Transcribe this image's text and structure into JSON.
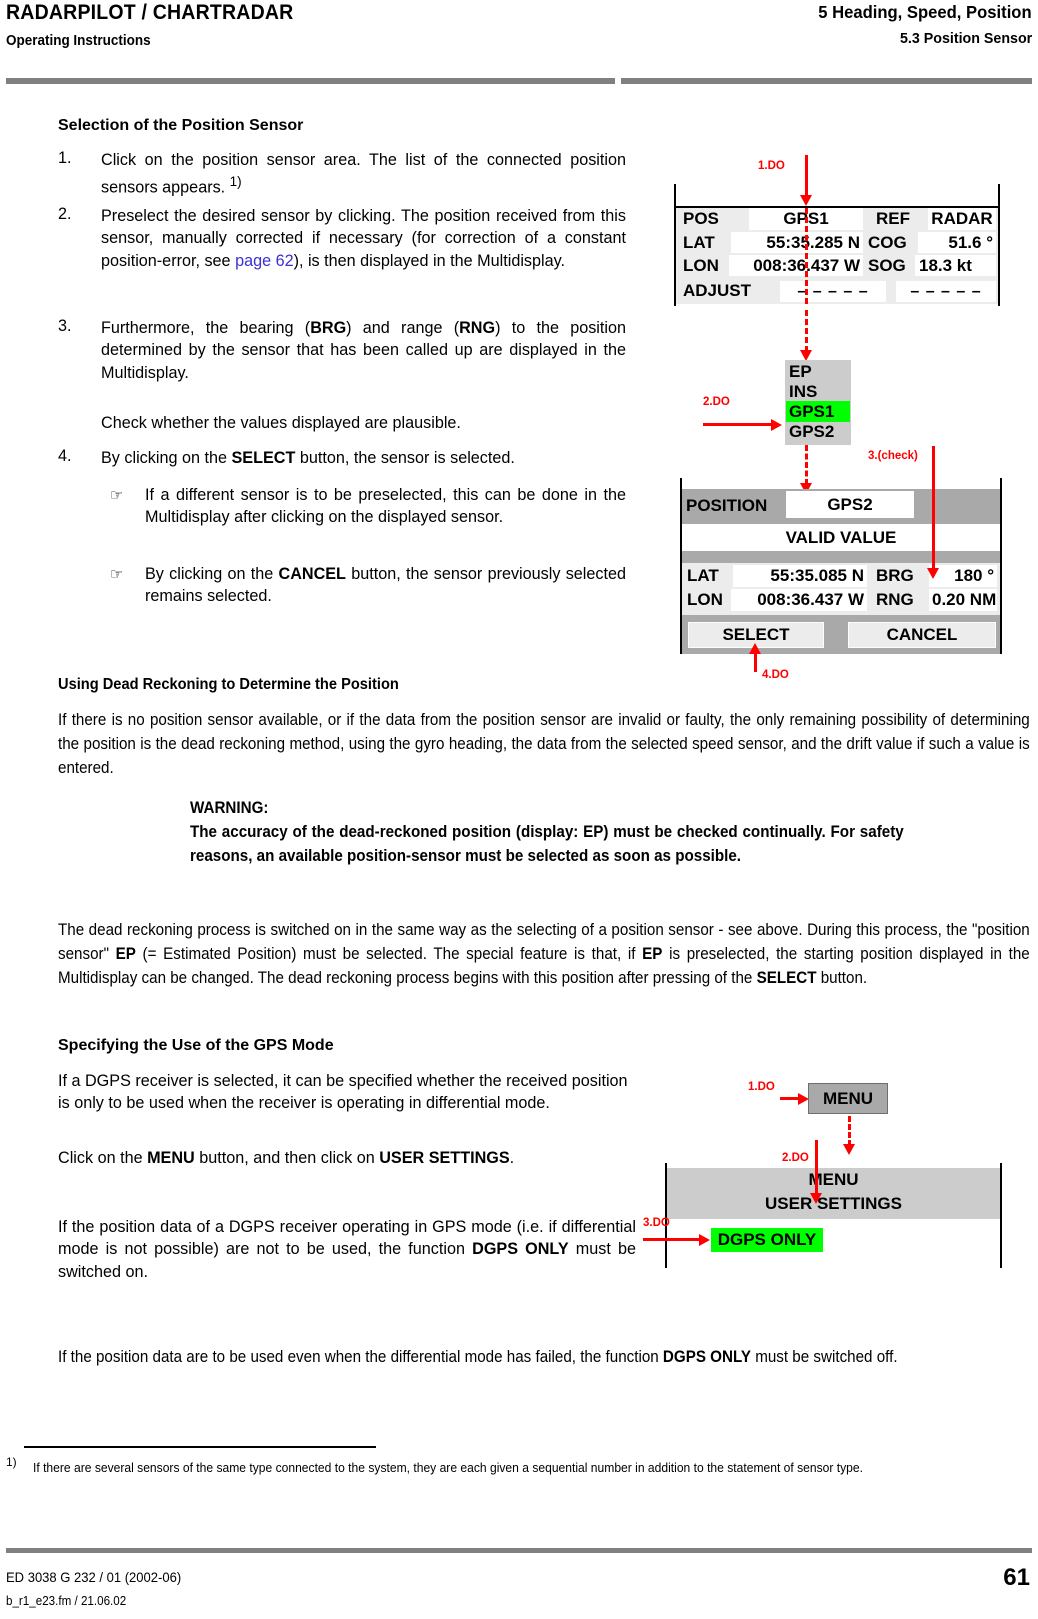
{
  "header": {
    "product": "RADARPILOT / CHARTRADAR",
    "doc_type": "Operating Instructions",
    "chapter": "5  Heading, Speed, Position",
    "section": "5.3  Position Sensor"
  },
  "sections": {
    "selection": {
      "heading": "Selection of the Position Sensor",
      "steps": [
        {
          "num": "1.",
          "text_html": "Click on the position sensor area. The list of the connected position sensors appears. <sup>1)</sup>"
        },
        {
          "num": "2.",
          "text_html": "Preselect the desired sensor by clicking. The position received from this sensor, manually corrected if necessary (for correction of a constant position-error, see <span class=\"lnk\">page 62</span>), is then displayed in the Multidisplay."
        },
        {
          "num": "3.",
          "text_html": "Furthermore, the bearing (<b>BRG</b>) and range (<b>RNG</b>) to the position determined by the sensor that has been called up are displayed in the Multidisplay."
        },
        {
          "num": "",
          "text_html": "Check whether the values displayed are plausible."
        },
        {
          "num": "4.",
          "text_html": "By clicking on the <b>SELECT</b> button, the sensor is selected."
        }
      ],
      "notes": [
        {
          "icon": "☞",
          "text_html": "If a different sensor is to be preselected, this can be done in the Multidisplay after clicking on the displayed sensor."
        },
        {
          "icon": "☞",
          "text_html": "By clicking on the <b>CANCEL</b> button, the sensor previously selected remains selected."
        }
      ]
    },
    "dead_reckoning": {
      "heading": "Using Dead Reckoning to Determine the Position",
      "intro_html": "If there is no position sensor available, or if the data from the position sensor are invalid or faulty, the only remaining possibility of determining the position is the dead reckoning method, using the gyro heading, the data from the selected speed sensor, and the drift value if such a value is entered.",
      "warning_label": "WARNING:",
      "warning_html": "The accuracy of the dead-reckoned position (display: EP) must be checked continually. For safety reasons, an available position-sensor must be selected as soon as possible.",
      "body_html": "The dead reckoning process is switched on in the same way as the selecting of a position sensor - see above. During this process, the \"position sensor\" <b>EP</b> (= Estimated Position) must be selected. The special feature is that, if <b>EP</b> is preselected, the starting position displayed in the Multidisplay can be changed. The dead reckoning process begins with this position after pressing of the <b>SELECT</b> button."
    },
    "gps_mode": {
      "heading": "Specifying the Use of the GPS Mode",
      "p1_html": "If a DGPS receiver is selected, it can be specified whether the received position is only to be used when the receiver is operating in differential mode.",
      "p2_html": "Click on the <b>MENU</b> button, and then click on <b>USER SETTINGS</b>.",
      "p3_html": "If the position data of a DGPS receiver operating in GPS mode (i.e. if differential mode is not possible) are not to be used, the function <b>DGPS ONLY</b> must be switched on.",
      "p4_html": "If the position data are to be used even when the differential mode has failed, the function <b>DGPS ONLY</b> must be switched off."
    }
  },
  "multidisplay_panel": {
    "callout": "1.DO",
    "rows": {
      "pos_label": "POS",
      "pos_value": "GPS1",
      "ref_label": "REF",
      "ref_value": "RADAR",
      "lat_label": "LAT",
      "lat_value": "55:35.285 N",
      "cog_label": "COG",
      "cog_value": "51.6 °",
      "lon_label": "LON",
      "lon_value": "008:36.437 W",
      "sog_label": "SOG",
      "sog_value": "18.3 kt",
      "adjust_label": "ADJUST",
      "adjust_value_1": "– – – – –",
      "adjust_value_2": "– – – – –"
    }
  },
  "sensor_list_panel": {
    "callout": "2.DO",
    "items": [
      {
        "label": "EP",
        "selected": false
      },
      {
        "label": "INS",
        "selected": false
      },
      {
        "label": "GPS1",
        "selected": true
      },
      {
        "label": "GPS2",
        "selected": false
      }
    ],
    "highlight_color": "#00ff00"
  },
  "position_panel": {
    "callout_check": "3.(check)",
    "callout_select": "4.DO",
    "title_label": "POSITION",
    "title_value": "GPS2",
    "valid_value": "VALID VALUE",
    "lat_label": "LAT",
    "lat_value": "55:35.085 N",
    "brg_label": "BRG",
    "brg_value": "180 °",
    "lon_label": "LON",
    "lon_value": "008:36.437 W",
    "rng_label": "RNG",
    "rng_value": "0.20 NM",
    "select_button": "SELECT",
    "cancel_button": "CANCEL"
  },
  "menu_panel": {
    "callout_1": "1.DO",
    "callout_2": "2.DO",
    "callout_3": "3.DO",
    "menu_button": "MENU",
    "menu_title": "MENU",
    "menu_subtitle": "USER SETTINGS",
    "dgps_only": "DGPS ONLY",
    "highlight_color": "#00ff00"
  },
  "footnote": {
    "mark": "1)",
    "text": "If there are several sensors of the same type connected to the system, they are each given a sequential number in addition to the statement of sensor type."
  },
  "footer": {
    "doc_id": "ED 3038 G 232 / 01 (2002-06)",
    "file_id": "b_r1_e23.fm / 21.06.02",
    "page_number": "61"
  }
}
